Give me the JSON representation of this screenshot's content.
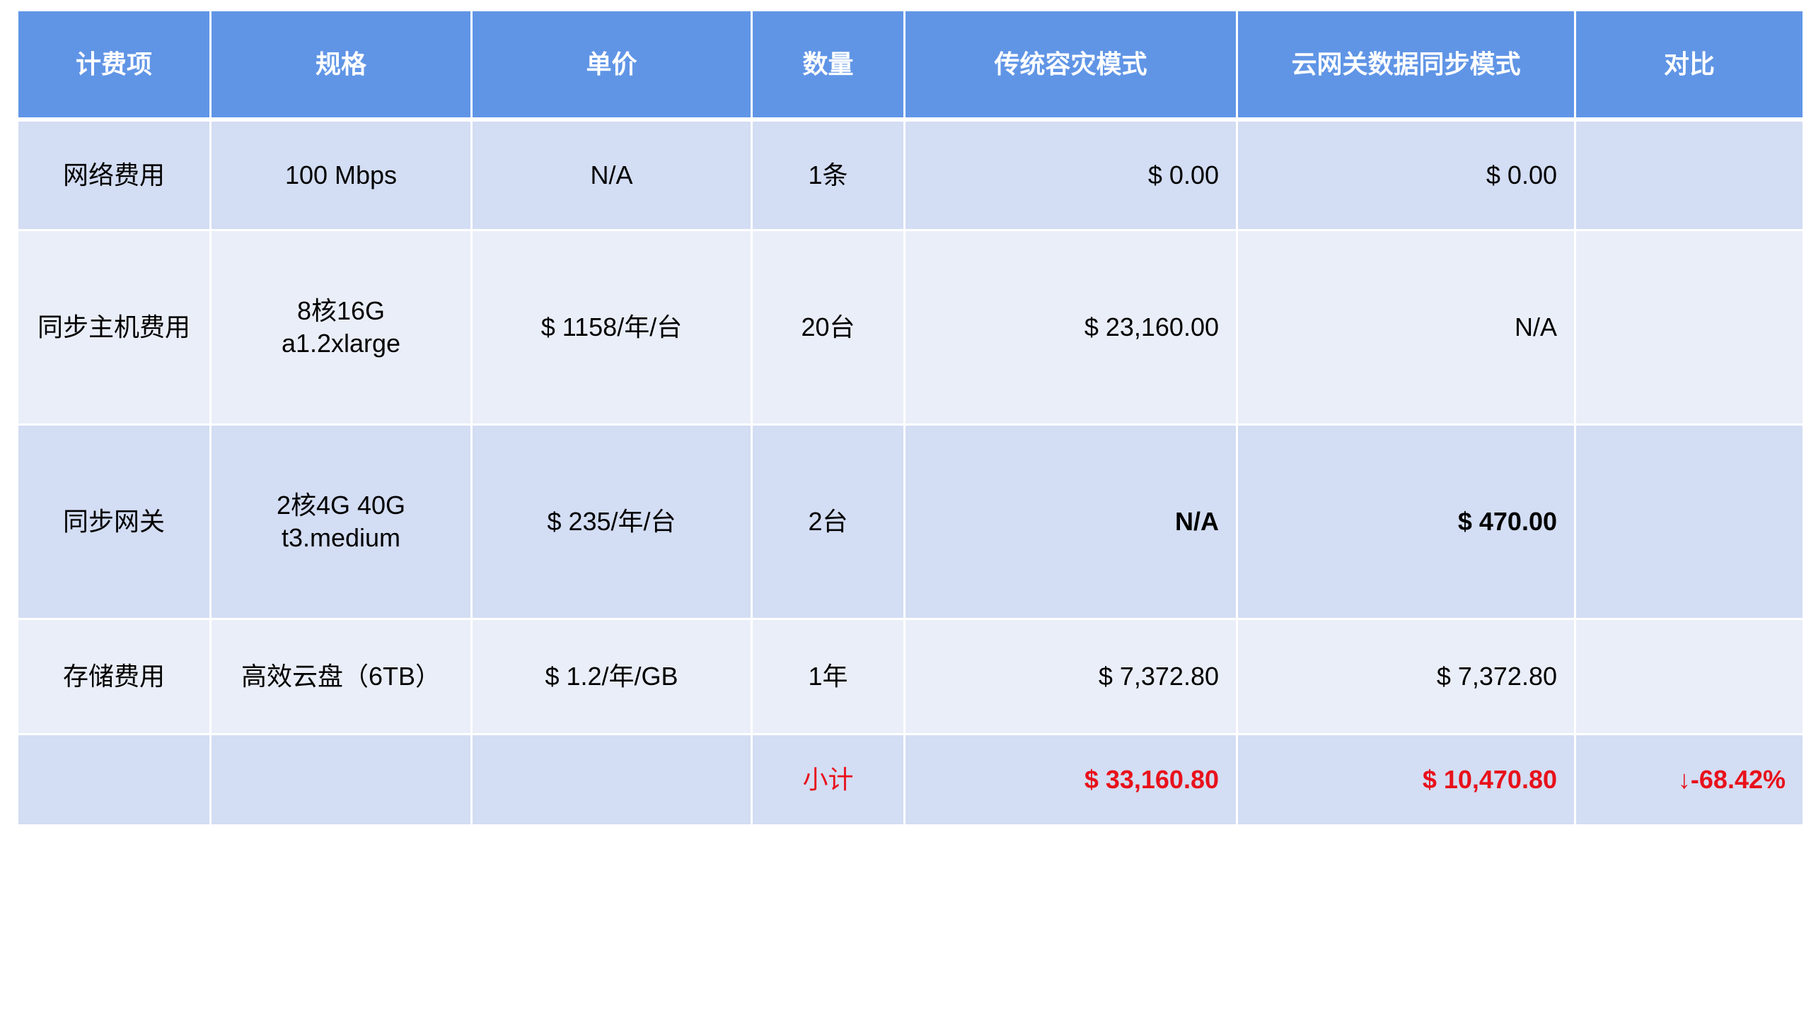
{
  "table": {
    "headers": [
      "计费项",
      "规格",
      "单价",
      "数量",
      "传统容灾模式",
      "云网关数据同步模式",
      "对比"
    ],
    "rows": [
      {
        "item": "网络费用",
        "spec_line1": "100 Mbps",
        "spec_line2": "",
        "unit_price": "N/A",
        "quantity": "1条",
        "traditional": "$ 0.00",
        "gateway": "$ 0.00",
        "compare": ""
      },
      {
        "item": "同步主机费用",
        "spec_line1": "8核16G",
        "spec_line2": "a1.2xlarge",
        "unit_price": "$ 1158/年/台",
        "quantity": "20台",
        "traditional": "$ 23,160.00",
        "gateway": "N/A",
        "compare": ""
      },
      {
        "item": "同步网关",
        "spec_line1": "2核4G 40G",
        "spec_line2": "t3.medium",
        "unit_price": "$ 235/年/台",
        "quantity": "2台",
        "traditional": "N/A",
        "gateway": "$ 470.00",
        "compare": ""
      },
      {
        "item": "存储费用",
        "spec_line1": "高效云盘（6TB）",
        "spec_line2": "",
        "unit_price": "$ 1.2/年/GB",
        "quantity": "1年",
        "traditional": "$ 7,372.80",
        "gateway": "$ 7,372.80",
        "compare": ""
      }
    ],
    "subtotal": {
      "label": "小计",
      "traditional": "$ 33,160.80",
      "gateway": "$ 10,470.80",
      "compare": "↓-68.42%"
    }
  },
  "colors": {
    "header_bg": "#6095e6",
    "row_dark": "#d3ddf3",
    "row_light": "#eaeef8",
    "highlight": "#e8111b"
  }
}
